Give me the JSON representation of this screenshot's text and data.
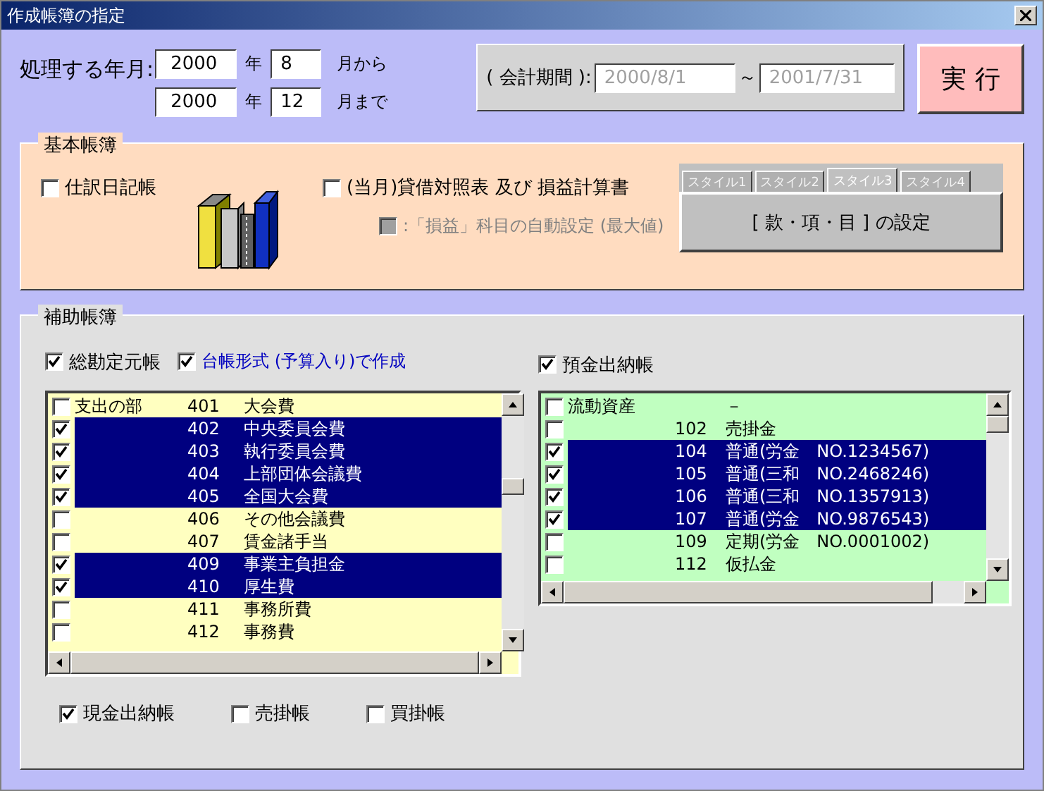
{
  "window": {
    "title": "作成帳簿の指定"
  },
  "period": {
    "label": "処理する年月:",
    "rows": [
      {
        "year": "2000",
        "year_unit": "年",
        "month": "8",
        "month_suffix": "月から"
      },
      {
        "year": "2000",
        "year_unit": "年",
        "month": "12",
        "month_suffix": "月まで"
      }
    ]
  },
  "fiscal": {
    "label": "( 会計期間 ):",
    "start": "2000/8/1",
    "separator": "～",
    "end": "2001/7/31"
  },
  "execute_button": "実 行",
  "basic": {
    "title": "基本帳簿",
    "journal": {
      "label": "仕訳日記帳",
      "checked": false
    },
    "statements": {
      "label": "(当月)貸借対照表 及び 損益計算書",
      "checked": false
    },
    "auto_setting": {
      "label": ":「損益」科目の自動設定 (最大値)",
      "checked": false,
      "disabled": true
    },
    "style_tabs": [
      {
        "label": "スタイル1",
        "selected": false
      },
      {
        "label": "スタイル2",
        "selected": false
      },
      {
        "label": "スタイル3",
        "selected": true
      },
      {
        "label": "スタイル4",
        "selected": false
      }
    ],
    "setting_button": "[ 款・項・目 ] の設定"
  },
  "auxiliary": {
    "title": "補助帳簿",
    "general_ledger": {
      "label": "総勘定元帳",
      "checked": true
    },
    "ledger_format": {
      "label": "台帳形式 (予算入り)で作成",
      "checked": true
    },
    "left_list": [
      {
        "group": "支出の部",
        "code": "401",
        "name": "大会費",
        "checked": false,
        "selected": false
      },
      {
        "code": "402",
        "name": "中央委員会費",
        "checked": true,
        "selected": true
      },
      {
        "code": "403",
        "name": "執行委員会費",
        "checked": true,
        "selected": true
      },
      {
        "code": "404",
        "name": "上部団体会議費",
        "checked": true,
        "selected": true
      },
      {
        "code": "405",
        "name": "全国大会費",
        "checked": true,
        "selected": true
      },
      {
        "code": "406",
        "name": "その他会議費",
        "checked": false,
        "selected": false
      },
      {
        "code": "407",
        "name": "賃金諸手当",
        "checked": false,
        "selected": false
      },
      {
        "code": "409",
        "name": "事業主負担金",
        "checked": true,
        "selected": true
      },
      {
        "code": "410",
        "name": "厚生費",
        "checked": true,
        "selected": true
      },
      {
        "code": "411",
        "name": "事務所費",
        "checked": false,
        "selected": false
      },
      {
        "code": "412",
        "name": "事務費",
        "checked": false,
        "selected": false
      }
    ],
    "deposit_book": {
      "label": "預金出納帳",
      "checked": true
    },
    "right_list": [
      {
        "group": "流動資産",
        "name": "－",
        "checked": false,
        "selected": false
      },
      {
        "code": "102",
        "name": "売掛金",
        "checked": false,
        "selected": false
      },
      {
        "code": "104",
        "name": "普通(労金　NO.1234567)",
        "checked": true,
        "selected": true
      },
      {
        "code": "105",
        "name": "普通(三和　NO.2468246)",
        "checked": true,
        "selected": true
      },
      {
        "code": "106",
        "name": "普通(三和　NO.1357913)",
        "checked": true,
        "selected": true
      },
      {
        "code": "107",
        "name": "普通(労金　NO.9876543)",
        "checked": true,
        "selected": true
      },
      {
        "code": "109",
        "name": "定期(労金　NO.0001002)",
        "checked": false,
        "selected": false
      },
      {
        "code": "112",
        "name": "仮払金",
        "checked": false,
        "selected": false
      }
    ],
    "bottom_checks": [
      {
        "label": "現金出納帳",
        "checked": true
      },
      {
        "label": "売掛帳",
        "checked": false
      },
      {
        "label": "買掛帳",
        "checked": false
      }
    ]
  }
}
